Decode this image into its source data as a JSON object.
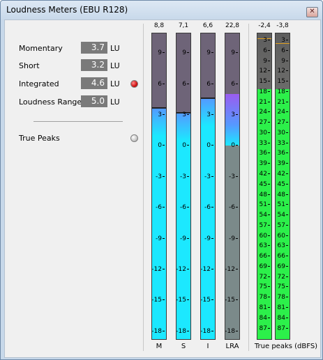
{
  "window": {
    "title": "Loudness Meters (EBU R128)",
    "close_glyph": "✕"
  },
  "readouts": [
    {
      "label": "Momentary",
      "value": "3.7",
      "unit": "LU"
    },
    {
      "label": "Short",
      "value": "3.2",
      "unit": "LU"
    },
    {
      "label": "Integrated",
      "value": "4.6",
      "unit": "LU",
      "indicator": "red"
    },
    {
      "label": "Loudness Range",
      "value": "5.0",
      "unit": "LU"
    }
  ],
  "true_peaks": {
    "label": "True Peaks",
    "indicator": "off"
  },
  "lu_meters": [
    {
      "id": "M",
      "label": "M",
      "max": "8,8",
      "level_lu": 3.7
    },
    {
      "id": "S",
      "label": "S",
      "max": "7,1",
      "level_lu": 3.2
    },
    {
      "id": "I",
      "label": "I",
      "max": "6,6",
      "level_lu": 4.6
    },
    {
      "id": "LRA",
      "label": "LRA",
      "max": "22,8",
      "range_low": 0,
      "range_high": 5.0
    }
  ],
  "lu_scale": [
    "9",
    "6",
    "3",
    "0",
    "-3",
    "-6",
    "-9",
    "-12",
    "-15",
    "-18"
  ],
  "tp_meters": [
    {
      "max": "-2,4",
      "peak_db": -2.4,
      "level_db": -18
    },
    {
      "max": "-3,8",
      "peak_db": -3.8,
      "level_db": -18
    }
  ],
  "tp_scale": [
    "3",
    "6",
    "9",
    "12",
    "15",
    "18",
    "21",
    "24",
    "27",
    "30",
    "33",
    "36",
    "39",
    "42",
    "45",
    "48",
    "51",
    "54",
    "57",
    "60",
    "63",
    "66",
    "69",
    "72",
    "75",
    "78",
    "81",
    "84",
    "87"
  ],
  "tp_label": "True peaks (dBFS)",
  "colors": {
    "cyan": "#1ce8ff",
    "blue": "#5599ff",
    "purple": "#9a5cf0",
    "gray": "#7b8a8a",
    "green": "#2cf04a",
    "dark": "#6e6478"
  }
}
